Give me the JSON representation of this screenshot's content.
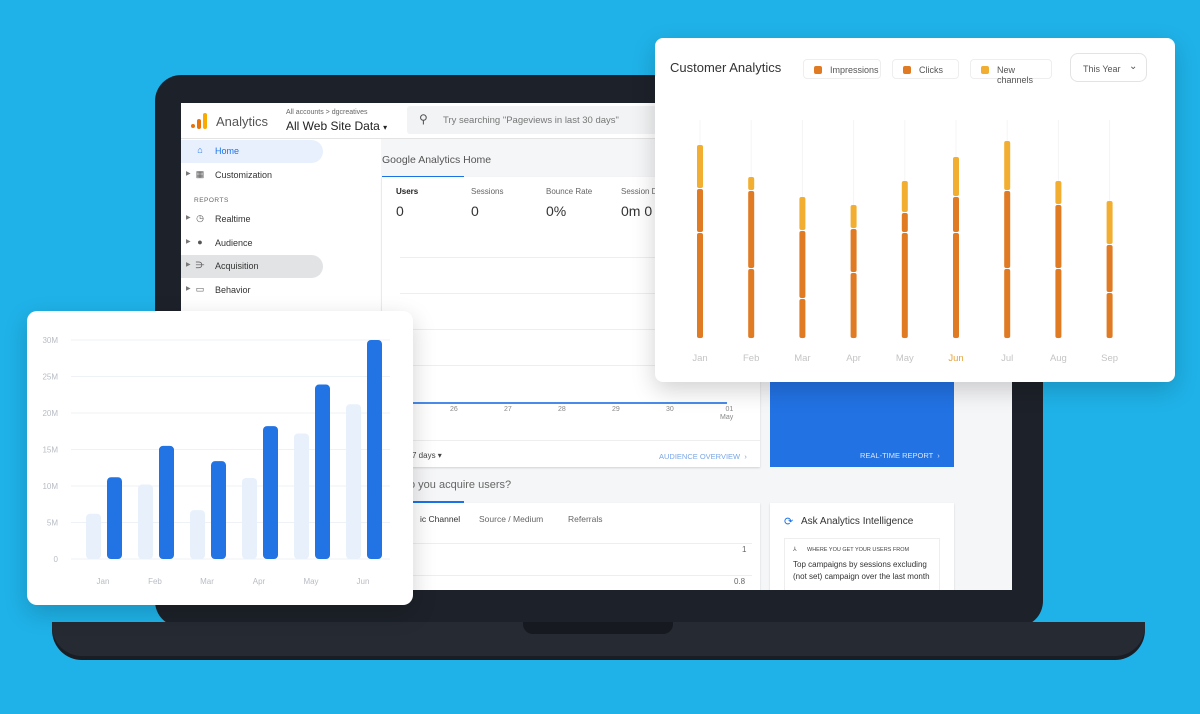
{
  "ga": {
    "app_name": "Analytics",
    "breadcrumb": "All accounts > dgcreatives",
    "property": "All Web Site Data",
    "search_placeholder": "Try searching \"Pageviews in last 30 days\"",
    "sidebar": [
      {
        "label": "Home",
        "icon": "home-icon",
        "active": true
      },
      {
        "label": "Customization",
        "icon": "grid-icon"
      },
      {
        "section": "REPORTS"
      },
      {
        "label": "Realtime",
        "icon": "clock-icon"
      },
      {
        "label": "Audience",
        "icon": "person-icon"
      },
      {
        "label": "Acquisition",
        "icon": "acquisition-icon",
        "selected": true
      },
      {
        "label": "Behavior",
        "icon": "window-icon"
      }
    ],
    "page_title": "Google Analytics Home",
    "metrics": [
      {
        "label": "Users",
        "value": "0"
      },
      {
        "label": "Sessions",
        "value": "0"
      },
      {
        "label": "Bounce Rate",
        "value": "0%"
      },
      {
        "label": "Session D",
        "value": "0m 0"
      }
    ],
    "x_labels": [
      "26",
      "27",
      "28",
      "29",
      "30",
      "01\nMay"
    ],
    "date_range": "7 days",
    "audience_link": "AUDIENCE OVERVIEW",
    "realtime_link": "REAL-TIME REPORT",
    "acquire_title": "o you acquire users?",
    "acquire_tabs": [
      "ic Channel",
      "Source / Medium",
      "Referrals"
    ],
    "acquire_ticks": [
      "1",
      "0.8"
    ],
    "intel_title": "Ask Analytics Intelligence",
    "intel_heading": "WHERE YOU GET YOUR USERS FROM",
    "intel_text": "Top campaigns by sessions excluding (not set) campaign over the last month"
  },
  "customer_analytics": {
    "title": "Customer Analytics",
    "period": "This Year",
    "legend": [
      {
        "name": "Impressions",
        "color": "#e07b24"
      },
      {
        "name": "Clicks",
        "color": "#e07b24"
      },
      {
        "name": "New channels",
        "color": "#f2ae30"
      }
    ],
    "highlight_month": "Jun",
    "highlight_color": "#e6a33a"
  },
  "chart_data": [
    {
      "type": "bar",
      "title": "Customer Analytics",
      "stacked": true,
      "categories": [
        "Jan",
        "Feb",
        "Mar",
        "Apr",
        "May",
        "Jun",
        "Jul",
        "Aug",
        "Sep"
      ],
      "series": [
        {
          "name": "Impressions",
          "values": [
            53,
            35,
            20,
            33,
            53,
            53,
            35,
            35,
            23
          ]
        },
        {
          "name": "Clicks",
          "values": [
            22,
            39,
            34,
            22,
            10,
            18,
            39,
            32,
            24
          ]
        },
        {
          "name": "New channels",
          "values": [
            22,
            7,
            17,
            12,
            16,
            20,
            25,
            12,
            22
          ]
        }
      ],
      "grid": false
    },
    {
      "type": "bar",
      "categories": [
        "Jan",
        "Feb",
        "Mar",
        "Apr",
        "May",
        "Jun"
      ],
      "yticks": [
        "0",
        "5M",
        "10M",
        "15M",
        "20M",
        "25M",
        "30M"
      ],
      "ylim": [
        0,
        30
      ],
      "series": [
        {
          "values": [
            6.2,
            10.2,
            6.7,
            11.1,
            17.2,
            21.2
          ],
          "color": "#e8f0fc"
        },
        {
          "values": [
            11.2,
            15.5,
            13.4,
            18.2,
            23.9,
            30.0
          ],
          "color": "#2273e3"
        }
      ],
      "grid": true
    }
  ]
}
